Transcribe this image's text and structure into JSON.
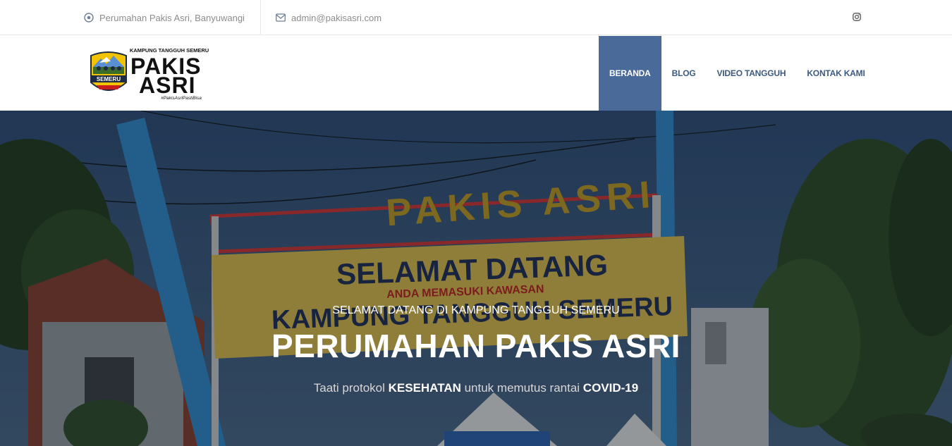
{
  "topbar": {
    "address": "Perumahan Pakis Asri, Banyuwangi",
    "address_icon": "map-pin-icon",
    "email": "admin@pakisasri.com",
    "email_icon": "envelope-icon",
    "social_icon": "instagram-icon"
  },
  "logo": {
    "top_text": "KAMPUNG TANGGUH SEMERU",
    "line1": "PAKIS",
    "line2": "ASRI",
    "hashtag": "#PakisAsriPastiBisa",
    "badge_text": "SEMERU",
    "badge_subtext": "KAMPUNG TANGGUH"
  },
  "nav": {
    "items": [
      {
        "label": "BERANDA",
        "active": true
      },
      {
        "label": "BLOG",
        "active": false
      },
      {
        "label": "VIDEO TANGGUH",
        "active": false
      },
      {
        "label": "KONTAK KAMI",
        "active": false
      }
    ]
  },
  "hero": {
    "kicker": "SELAMAT DATANG DI KAMPUNG TANGGUH SEMERU",
    "title": "PERUMAHAN PAKIS ASRI",
    "subtitle_part1": "Taati protokol ",
    "subtitle_bold1": "KESEHATAN",
    "subtitle_part2": " untuk memutus rantai ",
    "subtitle_bold2": "COVID-19",
    "gate_sign": "PAKIS ASRI",
    "banner_headline": "SELAMAT DATANG",
    "banner_line2": "ANDA MEMASUKI KAWASAN",
    "banner_line3": "KAMPUNG TANGGUH SEMERU"
  },
  "colors": {
    "nav_active_bg": "#4a6a9a",
    "nav_text": "#3d5a80",
    "topbar_text": "#8c8c8c"
  }
}
